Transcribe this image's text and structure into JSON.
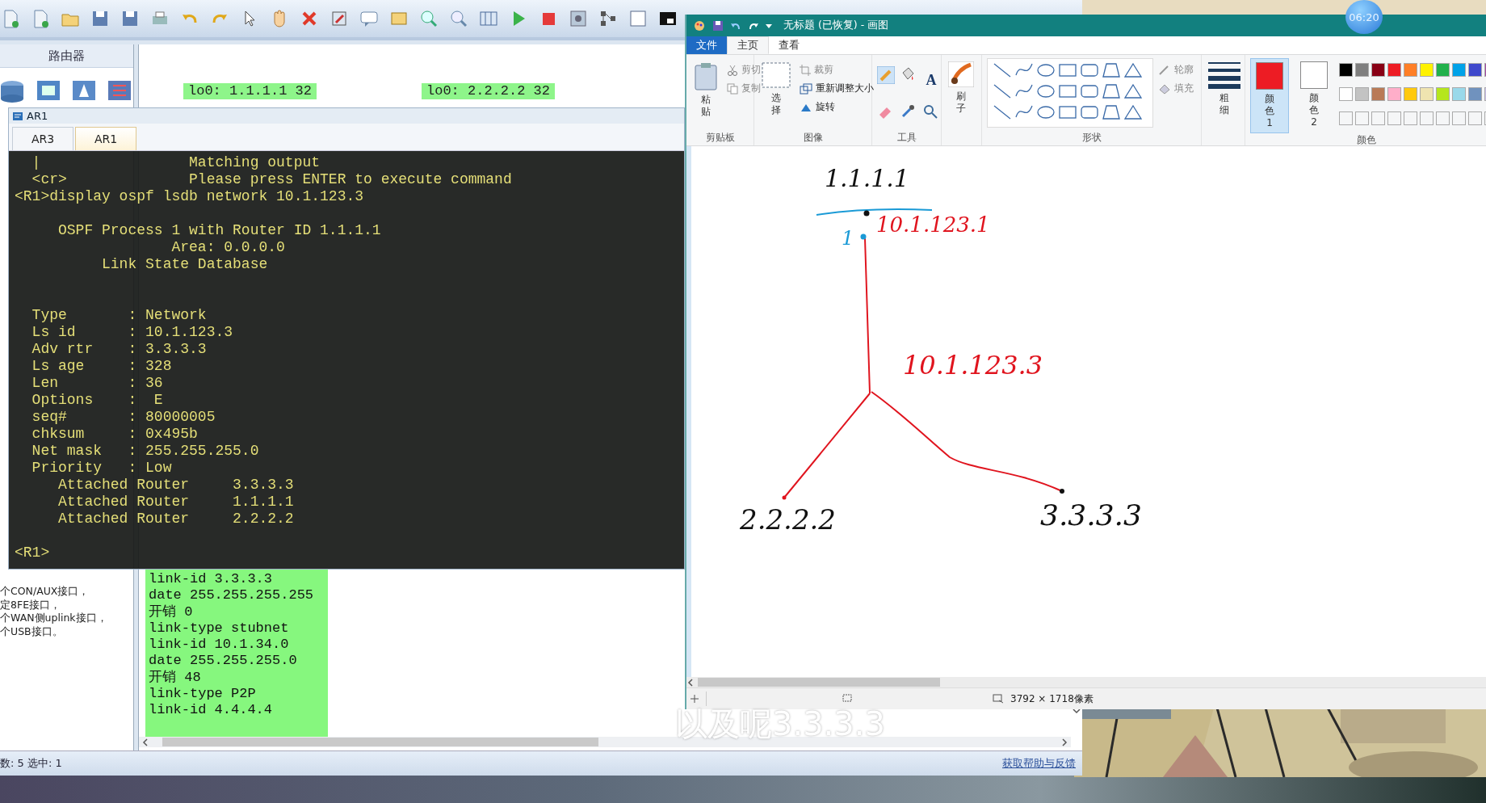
{
  "ensp": {
    "device_panel": {
      "title": "路由器"
    },
    "canvas": {
      "labels": [
        {
          "text": "lo0: 1.1.1.1 32"
        },
        {
          "text": "lo0: 2.2.2.2 32"
        }
      ],
      "note_lines": [
        "link-id 3.3.3.3",
        "date 255.255.255.255",
        "开销 0",
        "link-type stubnet",
        "link-id 10.1.34.0",
        "date 255.255.255.0",
        "开销 48",
        "link-type P2P",
        "link-id 4.4.4.4"
      ]
    },
    "device_info": [
      "个CON/AUX接口，",
      "定8FE接口，",
      "个WAN侧uplink接口，",
      "个USB接口。"
    ],
    "status": "数: 5 选中: 1",
    "help_link": "获取帮助与反馈"
  },
  "cli": {
    "title": "AR1",
    "tabs": [
      {
        "label": "AR3",
        "selected": false
      },
      {
        "label": "AR1",
        "selected": true
      }
    ],
    "blocks": [
      [
        "  |                 Matching output",
        "  <cr>              Please press ENTER to execute command",
        "<R1>display ospf lsdb network 10.1.123.3"
      ],
      [
        "     OSPF Process 1 with Router ID 1.1.1.1",
        "                  Area: 0.0.0.0",
        "          Link State Database"
      ],
      [
        "  Type       : Network",
        "  Ls id      : 10.1.123.3",
        "  Adv rtr    : 3.3.3.3",
        "  Ls age     : 328",
        "  Len        : 36",
        "  Options    :  E",
        "  seq#       : 80000005",
        "  chksum     : 0x495b",
        "  Net mask   : 255.255.255.0",
        "  Priority   : Low",
        "     Attached Router     3.3.3.3",
        "     Attached Router     1.1.1.1",
        "     Attached Router     2.2.2.2"
      ],
      [
        "<R1>"
      ]
    ]
  },
  "paint": {
    "title": "无标题 (已恢复) - 画图",
    "tabs": [
      {
        "label": "文件",
        "kind": "file",
        "selected": false
      },
      {
        "label": "主页",
        "kind": "tab",
        "selected": true
      },
      {
        "label": "查看",
        "kind": "tab",
        "selected": false
      }
    ],
    "clipboard": {
      "paste": "粘贴",
      "cut": "剪切",
      "copy": "复制",
      "group": "剪贴板"
    },
    "image": {
      "select": "选择",
      "crop": "裁剪",
      "resize": "重新调整大小",
      "rotate": "旋转",
      "group": "图像"
    },
    "tools": {
      "text_tool": "A",
      "group": "工具"
    },
    "brush": "刷子",
    "shapes": {
      "outline": "轮廓",
      "fill": "填充",
      "group": "形状"
    },
    "size": "粗细",
    "active_colors": [
      {
        "label": "颜色 1",
        "color": "#ed1c24",
        "selected": true
      },
      {
        "label": "颜色 2",
        "color": "#ffffff",
        "selected": false
      }
    ],
    "palette": [
      {
        "color": "#000000"
      },
      {
        "color": "#7f7f7f"
      },
      {
        "color": "#880015"
      },
      {
        "color": "#ed1c24"
      },
      {
        "color": "#ff7f27"
      },
      {
        "color": "#fff200"
      },
      {
        "color": "#22b14c"
      },
      {
        "color": "#00a2e8"
      },
      {
        "color": "#3f48cc"
      },
      {
        "color": "#a349a4"
      },
      {
        "color": "#ffffff"
      },
      {
        "color": "#c3c3c3"
      },
      {
        "color": "#b97a57"
      },
      {
        "color": "#ffaec9"
      },
      {
        "color": "#ffc90e"
      },
      {
        "color": "#efe4b0"
      },
      {
        "color": "#b5e61d"
      },
      {
        "color": "#99d9ea"
      },
      {
        "color": "#7092be"
      },
      {
        "color": "#c8bfe7"
      }
    ],
    "colors_group": "颜色",
    "drawing": {
      "labels": [
        {
          "text": "1.1.1.1",
          "color": "#111111"
        },
        {
          "text": "10.1.123.1",
          "color": "#e0141e"
        },
        {
          "text": "1",
          "color": "#1a9ad6"
        },
        {
          "text": "10.1.123.3",
          "color": "#e0141e"
        },
        {
          "text": "2.2.2.2",
          "color": "#111111"
        },
        {
          "text": "3.3.3.3",
          "color": "#111111"
        }
      ]
    },
    "status": {
      "size": "3792 × 1718像素"
    }
  },
  "video": {
    "timer": "06:20",
    "subtitle": "以及呢3.3.3.3"
  }
}
